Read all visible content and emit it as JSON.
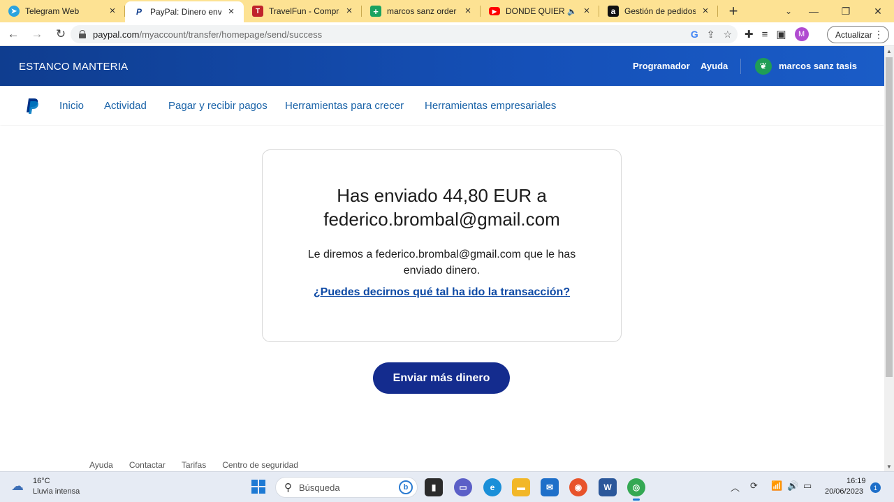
{
  "browser": {
    "tabs": [
      {
        "title": "Telegram Web",
        "icon": "telegram-icon",
        "color": "#2aa3df",
        "glyph": "➤"
      },
      {
        "title": "PayPal: Dinero enviado",
        "icon": "paypal-icon",
        "color": "#ffffff",
        "glyph": "P"
      },
      {
        "title": "TravelFun - Compra tu",
        "icon": "travelfun-icon",
        "color": "#c0232c",
        "glyph": "T"
      },
      {
        "title": "marcos sanz order - H",
        "icon": "sheets-icon",
        "color": "#1aa260",
        "glyph": "+"
      },
      {
        "title": "DONDE QUIERO E",
        "icon": "youtube-icon",
        "color": "#ff0000",
        "glyph": "▶"
      },
      {
        "title": "Gestión de pedidos",
        "icon": "amazon-icon",
        "color": "#111111",
        "glyph": "a"
      }
    ],
    "new_tab": "+",
    "url_host": "paypal.com",
    "url_path": "/myaccount/transfer/homepage/send/success",
    "profile_initial": "M",
    "update_label": "Actualizar"
  },
  "header": {
    "business_name": "ESTANCO MANTERIA",
    "developer_link": "Programador",
    "help_link": "Ayuda",
    "user_name": "marcos sanz tasis"
  },
  "nav": {
    "items": [
      "Inicio",
      "Actividad",
      "Pagar y recibir pagos",
      "Herramientas para crecer",
      "Herramientas empresariales"
    ]
  },
  "card": {
    "title_line1": "Has enviado 44,80 EUR a",
    "title_line2": "federico.brombal@gmail.com",
    "subtitle": "Le diremos a federico.brombal@gmail.com que le has enviado dinero.",
    "feedback_link": "¿Puedes decirnos qué tal ha ido la transacción?"
  },
  "send_more_button": "Enviar más dinero",
  "footer": {
    "links": [
      "Ayuda",
      "Contactar",
      "Tarifas",
      "Centro de seguridad"
    ]
  },
  "taskbar": {
    "weather_temp": "16°C",
    "weather_desc": "Lluvia intensa",
    "search_placeholder": "Búsqueda",
    "time": "16:19",
    "date": "20/06/2023",
    "notification_count": "1"
  },
  "colors": {
    "header_blue": "#1550b8",
    "nav_link": "#1a63a8",
    "button_navy": "#142c8e",
    "link_blue": "#0e4aa5",
    "tabstrip_yellow": "#fde293"
  }
}
